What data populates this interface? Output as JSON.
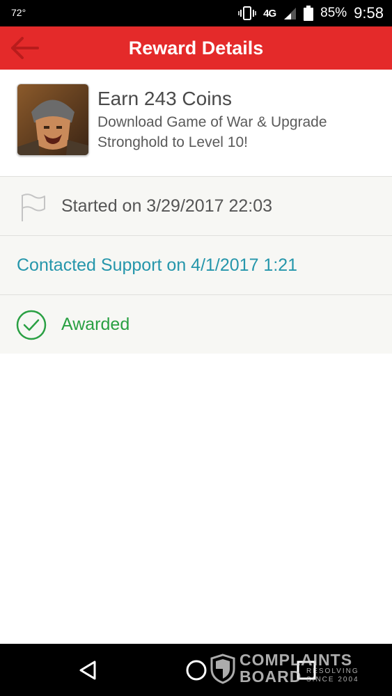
{
  "status_bar": {
    "temperature": "72°",
    "network": "4G",
    "battery_percent": "85%",
    "time": "9:58",
    "icons": [
      "vibrate-icon",
      "network-4g-lte-icon",
      "signal-icon",
      "battery-icon"
    ]
  },
  "app_bar": {
    "title": "Reward Details",
    "color": "#e42a2a",
    "back_icon": "arrow-left-icon"
  },
  "offer": {
    "title": "Earn 243 Coins",
    "description": "Download Game of War & Upgrade Stronghold to Level 10!"
  },
  "timeline": {
    "started": "Started on 3/29/2017 22:03",
    "started_icon": "flag-icon",
    "support": "Contacted Support on 4/1/2017 1:21",
    "support_color": "#2596ab",
    "awarded": "Awarded",
    "awarded_icon": "check-circle-icon",
    "awarded_color": "#2aa043"
  },
  "nav_bar": {
    "icons": [
      "back-triangle-icon",
      "home-circle-icon",
      "recents-square-icon"
    ]
  },
  "watermark": {
    "brand_line1": "COMPLAINTS",
    "brand_line2": "BOARD",
    "tagline_line1": "RESOLVING",
    "tagline_line2": "SINCE 2004"
  }
}
